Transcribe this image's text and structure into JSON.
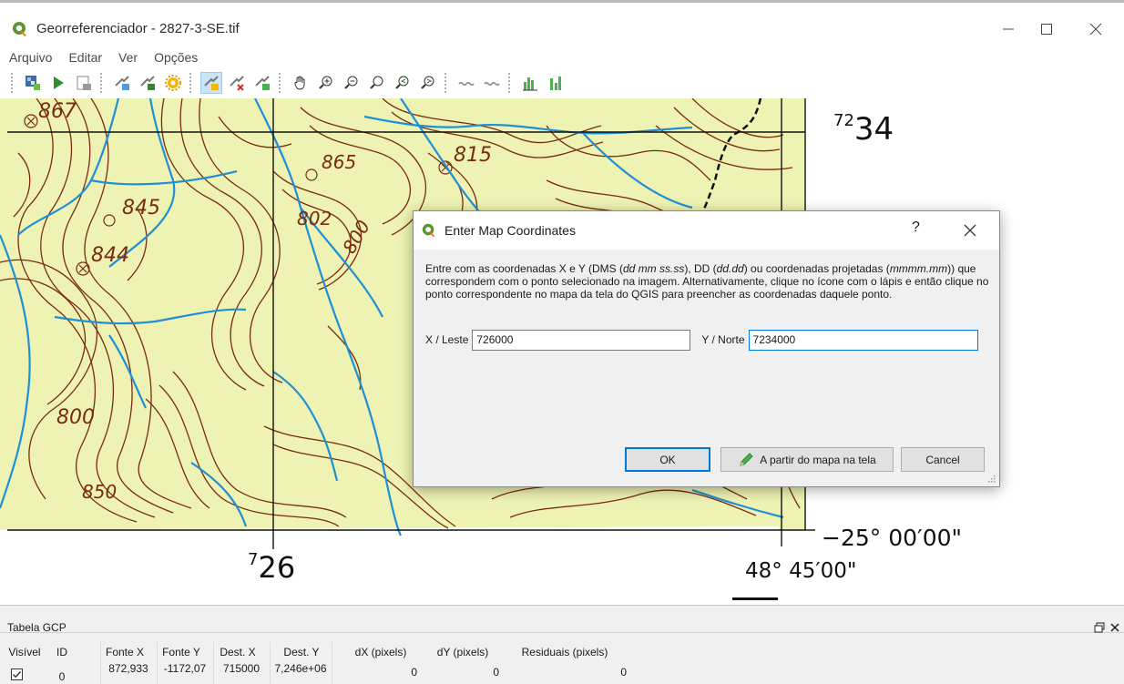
{
  "window": {
    "title": "Georreferenciador - 2827-3-SE.tif",
    "minimize_icon": "minimize-icon",
    "maximize_icon": "maximize-icon",
    "close_icon": "close-icon"
  },
  "menu": [
    "Arquivo",
    "Editar",
    "Ver",
    "Opções"
  ],
  "toolbar": {
    "icons": [
      "open-raster-icon",
      "start-georeferencing-icon",
      "generate-gdal-script-icon",
      "load-gcp-points-icon",
      "save-gcp-points-icon",
      "transformation-settings-icon",
      "add-point-icon",
      "delete-point-icon",
      "move-gcp-point-icon",
      "pan-icon",
      "zoom-in-icon",
      "zoom-out-icon",
      "zoom-to-layer-icon",
      "zoom-last-icon",
      "zoom-next-icon",
      "link-georeferencer-to-qgis-icon",
      "link-qgis-to-georeferencer-icon",
      "full-histogram-stretch-icon",
      "local-histogram-stretch-icon"
    ]
  },
  "map": {
    "labels": {
      "northing_top": {
        "sup": "72",
        "main": "34"
      },
      "easting_bottom": {
        "sup": "7",
        "main": "26"
      },
      "latitude": "−25° 00′00\"",
      "longitude": "48° 45′00\"",
      "contours": [
        "867",
        "845",
        "844",
        "865",
        "815",
        "802",
        "800",
        "800",
        "850"
      ]
    },
    "colors": {
      "land": "#eef3b3",
      "contour": "#7a2a12",
      "water": "#1f8fd6",
      "grid": "#111111"
    }
  },
  "dialog": {
    "title": "Enter Map Coordinates",
    "help": "?",
    "body_parts": [
      "Entre com as coordenadas X e Y (DMS (",
      "dd mm ss.ss",
      "), DD (",
      "dd.dd",
      ") ou coordenadas projetadas (",
      "mmmm.mm",
      ")) que correspondem com o ponto selecionado na imagem. Alternativamente, clique no ícone com o lápis e então clique no ponto correspondente no mapa da tela do QGIS para preencher as coordenadas daquele ponto."
    ],
    "x_label": "X / Leste",
    "x_value": "726000",
    "y_label": "Y / Norte",
    "y_value": "7234000",
    "ok_label": "OK",
    "from_canvas_label": "A partir do mapa na tela",
    "cancel_label": "Cancel"
  },
  "gcp_table": {
    "title": "Tabela GCP",
    "float_icon": "float-dock-icon",
    "close_icon": "close-dock-icon",
    "columns": [
      "Visível",
      "ID",
      "Fonte X",
      "Fonte Y",
      "Dest. X",
      "Dest. Y",
      "dX (pixels)",
      "dY (pixels)",
      "Residuais (pixels)"
    ],
    "rows": [
      {
        "visible": true,
        "id": "0",
        "src_x": "872,933",
        "src_y": "-1172,07",
        "dst_x": "715000",
        "dst_y": "7,246e+06",
        "dx": "0",
        "dy": "0",
        "residual": "0"
      }
    ]
  }
}
